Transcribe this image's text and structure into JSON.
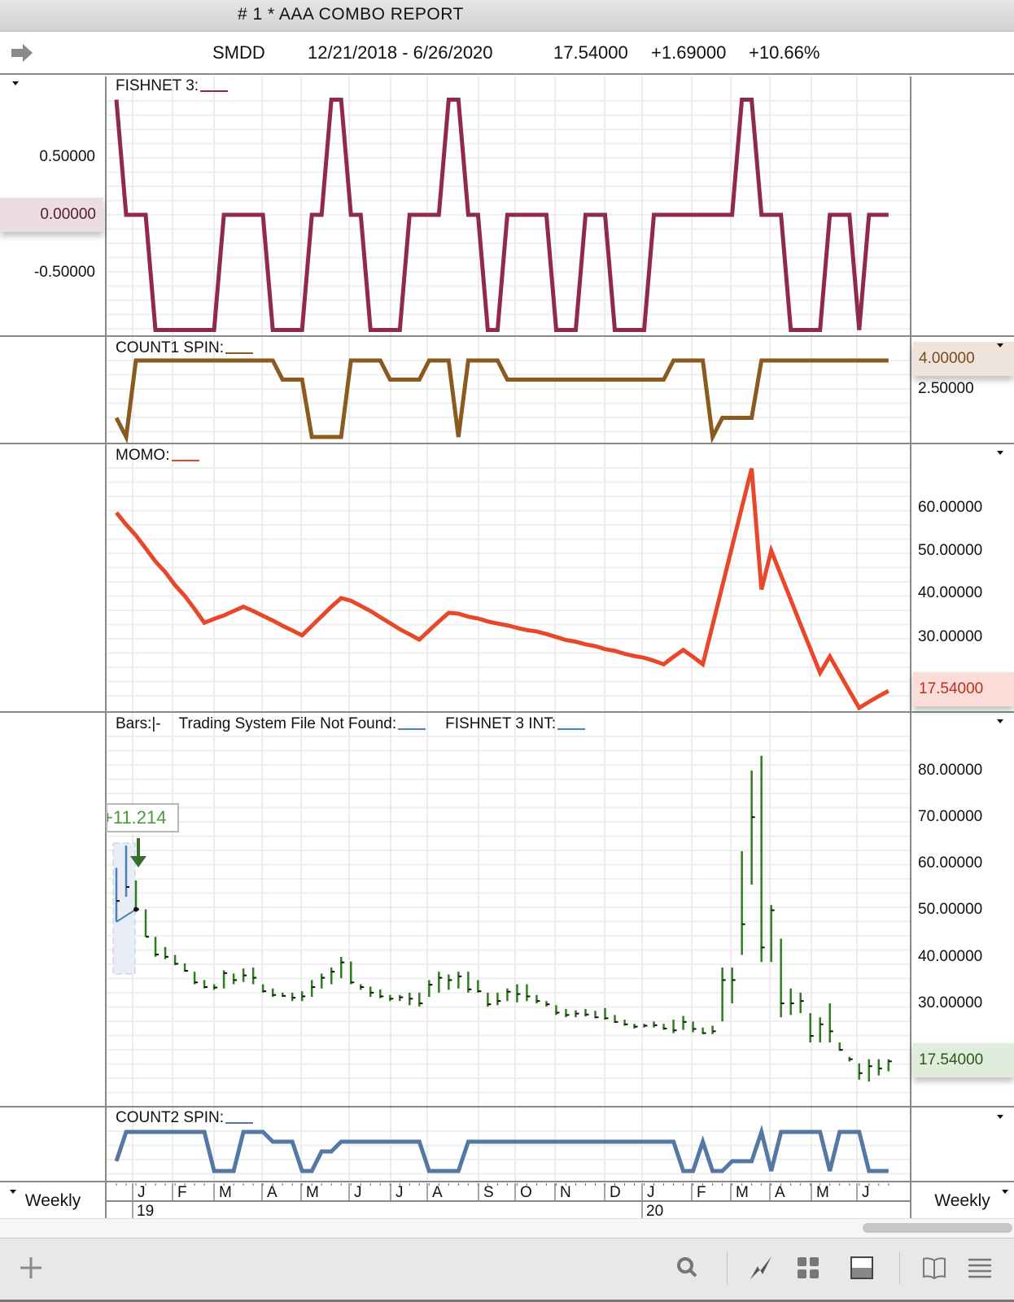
{
  "window": {
    "title": "# 1 * AAA  COMBO  REPORT"
  },
  "header": {
    "symbol": "SMDD",
    "date_range": "12/21/2018 - 6/26/2020",
    "last": "17.54000",
    "change": "+1.69000",
    "change_pct": "+10.66%"
  },
  "panels": {
    "fishnet": {
      "title": "FISHNET 3:",
      "axis": [
        "0.50000",
        "0.00000",
        "-0.50000"
      ],
      "color": "#8e2a52"
    },
    "count1": {
      "title": "COUNT1 SPIN:",
      "axis": [
        "4.00000",
        "2.50000"
      ],
      "color": "#8a5a1e"
    },
    "momo": {
      "title": "MOMO:",
      "axis": [
        "60.00000",
        "50.00000",
        "40.00000",
        "30.00000",
        "17.54000"
      ],
      "color": "#e8472a"
    },
    "bars": {
      "title_bars": "Bars:",
      "title_bars_sym": "|-",
      "title_ts": "Trading System File Not Found:",
      "title_fi": "FISHNET 3 INT:",
      "axis": [
        "80.00000",
        "70.00000",
        "60.00000",
        "50.00000",
        "40.00000",
        "30.00000",
        "17.54000"
      ],
      "trade_label": "+11.214",
      "color": "#2f7d1e",
      "selected_color": "#4f7fb5"
    },
    "count2": {
      "title": "COUNT2 SPIN:",
      "color": "#5577a3"
    }
  },
  "xaxis": {
    "periodicity": "Weekly",
    "months": [
      "J",
      "F",
      "M",
      "A",
      "M",
      "J",
      "J",
      "A",
      "S",
      "O",
      "N",
      "D",
      "J",
      "F",
      "M",
      "A",
      "M",
      "J"
    ],
    "years": [
      "19",
      "20"
    ]
  },
  "toolbar": {
    "icons": [
      "plus-icon",
      "search-icon",
      "lightning-icon",
      "grid-icon",
      "panel-icon",
      "book-icon",
      "menu-icon"
    ]
  },
  "chart_data": [
    {
      "type": "line",
      "title": "FISHNET 3",
      "ylim": [
        -1,
        1
      ],
      "values": [
        1,
        0,
        0,
        0,
        -1,
        -1,
        -1,
        -1,
        -1,
        -1,
        -1,
        0,
        0,
        0,
        0,
        0,
        -1,
        -1,
        -1,
        -1,
        0,
        0,
        1,
        1,
        0,
        0,
        -1,
        -1,
        -1,
        -1,
        0,
        0,
        0,
        0,
        1,
        1,
        0,
        0,
        -1,
        -1,
        0,
        0,
        0,
        0,
        0,
        -1,
        -1,
        -1,
        0,
        0,
        0,
        -1,
        -1,
        -1,
        -1,
        0,
        0,
        0,
        0,
        0,
        0,
        0,
        0,
        0,
        1,
        1,
        0,
        0,
        0,
        -1,
        -1,
        -1,
        -1,
        0,
        0,
        0,
        -1,
        0,
        0,
        0
      ]
    },
    {
      "type": "line",
      "title": "COUNT1 SPIN",
      "ylim": [
        0,
        4
      ],
      "values": [
        1,
        0,
        4,
        4,
        4,
        4,
        4,
        4,
        4,
        4,
        4,
        4,
        4,
        4,
        4,
        4,
        4,
        3,
        3,
        3,
        0,
        0,
        0,
        0,
        4,
        4,
        4,
        4,
        3,
        3,
        3,
        3,
        4,
        4,
        4,
        0,
        4,
        4,
        4,
        4,
        3,
        3,
        3,
        3,
        3,
        3,
        3,
        3,
        3,
        3,
        3,
        3,
        3,
        3,
        3,
        3,
        3,
        4,
        4,
        4,
        4,
        0,
        1,
        1,
        1,
        1,
        4,
        4,
        4,
        4,
        4,
        4,
        4,
        4,
        4,
        4,
        4,
        4,
        4,
        4
      ]
    },
    {
      "type": "line",
      "title": "MOMO",
      "ylim": [
        10,
        70
      ],
      "values": [
        58.8,
        56,
        53.5,
        50.5,
        47.5,
        45,
        42,
        39.5,
        36.5,
        33.3,
        34.2,
        35,
        36,
        37,
        36,
        34.9,
        33.8,
        32.6,
        31.5,
        30.4,
        32.6,
        34.8,
        37,
        39,
        38.4,
        37.2,
        36,
        34.6,
        33.2,
        31.8,
        30.6,
        29.4,
        31.5,
        33.6,
        35.6,
        35.4,
        34.7,
        34.3,
        33.6,
        33.1,
        32.7,
        32.1,
        31.6,
        31.3,
        30.7,
        30,
        29.3,
        28.9,
        28.3,
        27.9,
        27.2,
        26.8,
        26.1,
        25.6,
        25.2,
        24.5,
        23.7,
        25.4,
        27,
        25.4,
        23.7,
        32.7,
        41.8,
        50.9,
        60,
        69,
        41,
        50,
        44.3,
        38.6,
        32.9,
        27.3,
        21.7,
        25.5,
        21.5,
        17.5,
        13.6,
        15,
        16.3,
        17.54
      ]
    },
    {
      "type": "ohlc",
      "title": "SMDD Weekly Bars",
      "ylim": [
        10,
        85
      ],
      "fields": [
        "high",
        "low",
        "close"
      ],
      "values": [
        [
          59.1,
          47.5,
          52
        ],
        [
          63.9,
          52.9,
          55
        ],
        [
          56.4,
          50.2,
          50.2
        ],
        [
          50.2,
          44.3,
          44.3
        ],
        [
          44.3,
          40,
          40.5
        ],
        [
          42.1,
          39.5,
          40
        ],
        [
          40.4,
          38.2,
          38.5
        ],
        [
          38.6,
          36.8,
          37
        ],
        [
          36.8,
          34.1,
          34.5
        ],
        [
          35,
          33.2,
          33.5
        ],
        [
          34.1,
          32.9,
          33.4
        ],
        [
          37.1,
          33.2,
          36.5
        ],
        [
          36.4,
          34.1,
          35
        ],
        [
          37.5,
          34.6,
          36
        ],
        [
          37.7,
          34.1,
          35.5
        ],
        [
          34.1,
          32.3,
          32.6
        ],
        [
          33.2,
          31.4,
          31.8
        ],
        [
          32.3,
          31.4,
          31.6
        ],
        [
          32.3,
          30.5,
          31.2
        ],
        [
          32.6,
          30.5,
          31.5
        ],
        [
          35,
          31.4,
          33.5
        ],
        [
          36.4,
          33.2,
          35.5
        ],
        [
          37.7,
          34.1,
          36.8
        ],
        [
          40,
          35.4,
          38.8
        ],
        [
          39,
          34.1,
          34.5
        ],
        [
          34.1,
          32.9,
          33.5
        ],
        [
          33.6,
          31.4,
          32.3
        ],
        [
          33,
          31.1,
          31.5
        ],
        [
          31.8,
          30.5,
          31
        ],
        [
          31.8,
          30.5,
          31.3
        ],
        [
          32.3,
          29.6,
          31
        ],
        [
          32.3,
          29.3,
          30
        ],
        [
          35,
          31.4,
          34
        ],
        [
          36.8,
          32.3,
          35.5
        ],
        [
          36.2,
          32.9,
          35
        ],
        [
          36.8,
          33.2,
          35.8
        ],
        [
          36.8,
          32.3,
          33
        ],
        [
          35,
          32.3,
          32.6
        ],
        [
          32.3,
          29.3,
          29.8
        ],
        [
          32.3,
          29.6,
          30.5
        ],
        [
          33.2,
          30.5,
          32.5
        ],
        [
          34.1,
          30.2,
          32
        ],
        [
          34.1,
          30.5,
          31.5
        ],
        [
          31.8,
          30,
          30.5
        ],
        [
          30.5,
          29.3,
          29.8
        ],
        [
          29.6,
          27.5,
          28
        ],
        [
          28.8,
          27,
          27.5
        ],
        [
          28.5,
          27,
          27.8
        ],
        [
          28.8,
          27.2,
          27.6
        ],
        [
          28.4,
          26.8,
          27
        ],
        [
          29,
          26.5,
          26.8
        ],
        [
          27.5,
          25.8,
          26
        ],
        [
          26.5,
          25.2,
          25.5
        ],
        [
          25.6,
          24.6,
          25
        ],
        [
          25.6,
          24.8,
          25.2
        ],
        [
          26.1,
          24.8,
          25.3
        ],
        [
          25.6,
          24.3,
          24.6
        ],
        [
          26.5,
          23.6,
          24.2
        ],
        [
          27.3,
          24.3,
          26
        ],
        [
          26.1,
          23.8,
          24.5
        ],
        [
          24.8,
          23.4,
          23.6
        ],
        [
          25.2,
          23.4,
          24
        ],
        [
          37.7,
          26.1,
          35
        ],
        [
          37.7,
          30,
          35
        ],
        [
          62.7,
          40.4,
          47
        ],
        [
          80,
          55.5,
          70
        ],
        [
          83.2,
          38.9,
          42
        ],
        [
          51.1,
          38.9,
          50
        ],
        [
          43.9,
          27,
          30
        ],
        [
          33.2,
          27.5,
          30
        ],
        [
          32.3,
          27.9,
          30.5
        ],
        [
          27.9,
          21.6,
          23
        ],
        [
          27,
          21.6,
          25.5
        ],
        [
          30,
          21.6,
          24
        ],
        [
          21.6,
          19.8,
          20
        ],
        [
          18.5,
          17.5,
          18
        ],
        [
          17.1,
          13.6,
          15
        ],
        [
          18,
          13.2,
          16.5
        ],
        [
          18,
          14.5,
          16
        ],
        [
          18,
          15.4,
          17.54
        ]
      ]
    },
    {
      "type": "line",
      "title": "COUNT2 SPIN",
      "ylim": [
        0,
        4
      ],
      "values": [
        1,
        4,
        4,
        4,
        4,
        4,
        4,
        4,
        4,
        4,
        0,
        0,
        0,
        4,
        4,
        4,
        3,
        3,
        3,
        0,
        0,
        2,
        2,
        3,
        3,
        3,
        3,
        3,
        3,
        3,
        3,
        3,
        0,
        0,
        0,
        0,
        3,
        3,
        3,
        3,
        3,
        3,
        3,
        3,
        3,
        3,
        3,
        3,
        3,
        3,
        3,
        3,
        3,
        3,
        3,
        3,
        3,
        3,
        0,
        0,
        3,
        0,
        0,
        1,
        1,
        1,
        4,
        0,
        4,
        4,
        4,
        4,
        4,
        0,
        4,
        4,
        4,
        0,
        0,
        0
      ]
    }
  ]
}
